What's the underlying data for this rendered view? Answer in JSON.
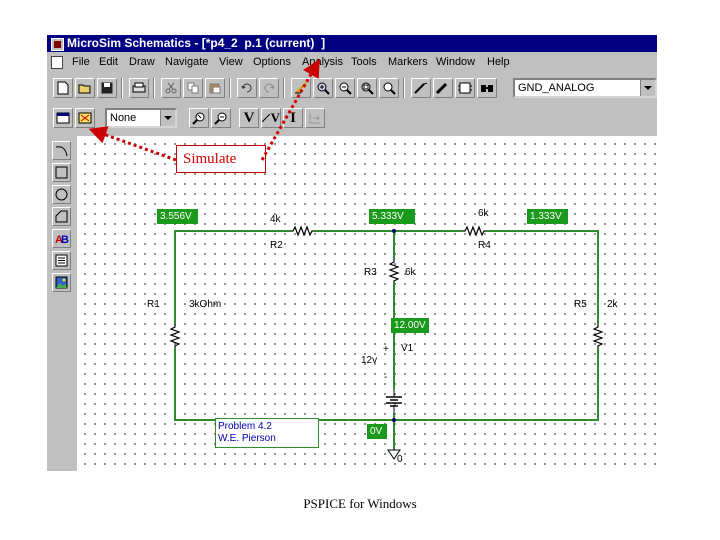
{
  "window": {
    "title": "MicroSim Schematics - [*p4_2  p.1 (current)  ]",
    "icon": "schematics-app-icon"
  },
  "menubar": {
    "items": [
      "File",
      "Edit",
      "Draw",
      "Navigate",
      "View",
      "Options",
      "Analysis",
      "Tools",
      "Markers",
      "Window",
      "Help"
    ]
  },
  "toolbar1": {
    "part_combo_value": "GND_ANALOG",
    "icons": [
      "new-file-icon",
      "open-folder-icon",
      "save-icon",
      "print-icon",
      "cut-icon",
      "copy-icon",
      "paste-icon",
      "undo-icon",
      "redo-icon",
      "redraw-icon",
      "zoom-in-icon",
      "zoom-out-icon",
      "zoom-area-icon",
      "zoom-fit-icon",
      "draw-wire-icon",
      "draw-bus-icon",
      "draw-block-icon",
      "get-part-icon"
    ]
  },
  "toolbar2": {
    "sim_combo_value": "None",
    "voltage_label": "V",
    "voltage_diff_label": "V",
    "current_label": "I"
  },
  "palette": {
    "icons": [
      "arc-icon",
      "rectangle-icon",
      "circle-icon",
      "polyline-icon",
      "text-icon",
      "text-box-icon",
      "insert-picture-icon"
    ]
  },
  "schematic": {
    "voltage_labels": {
      "node_left": "3.556V",
      "node_mid": "5.333V",
      "node_right": "1.333V",
      "source_top": "12.00V",
      "ground": "0V"
    },
    "components": {
      "R1": {
        "name": "R1",
        "value": "3kOhm"
      },
      "R2": {
        "name": "R2",
        "value": "4k"
      },
      "R3": {
        "name": "R3",
        "value": "6k"
      },
      "R4": {
        "name": "R4",
        "value": "6k"
      },
      "R5": {
        "name": "R5",
        "value": "2k"
      },
      "V1": {
        "name": "V1",
        "value": "12v",
        "plus": "+",
        "minus": "-"
      },
      "ground": {
        "label": "0"
      }
    },
    "info_box": {
      "line1": "Problem 4.2",
      "line2": "W.E. Pierson"
    }
  },
  "annotation": {
    "simulate_label": "Simulate"
  },
  "footer": {
    "caption": "PSPICE for Windows"
  },
  "colors": {
    "title_bar": "#000080",
    "window_face": "#c0c0c0",
    "wire": "#2e8b2e",
    "voltage_label_bg": "#1a9a1a",
    "annotation": "#cc0000"
  }
}
